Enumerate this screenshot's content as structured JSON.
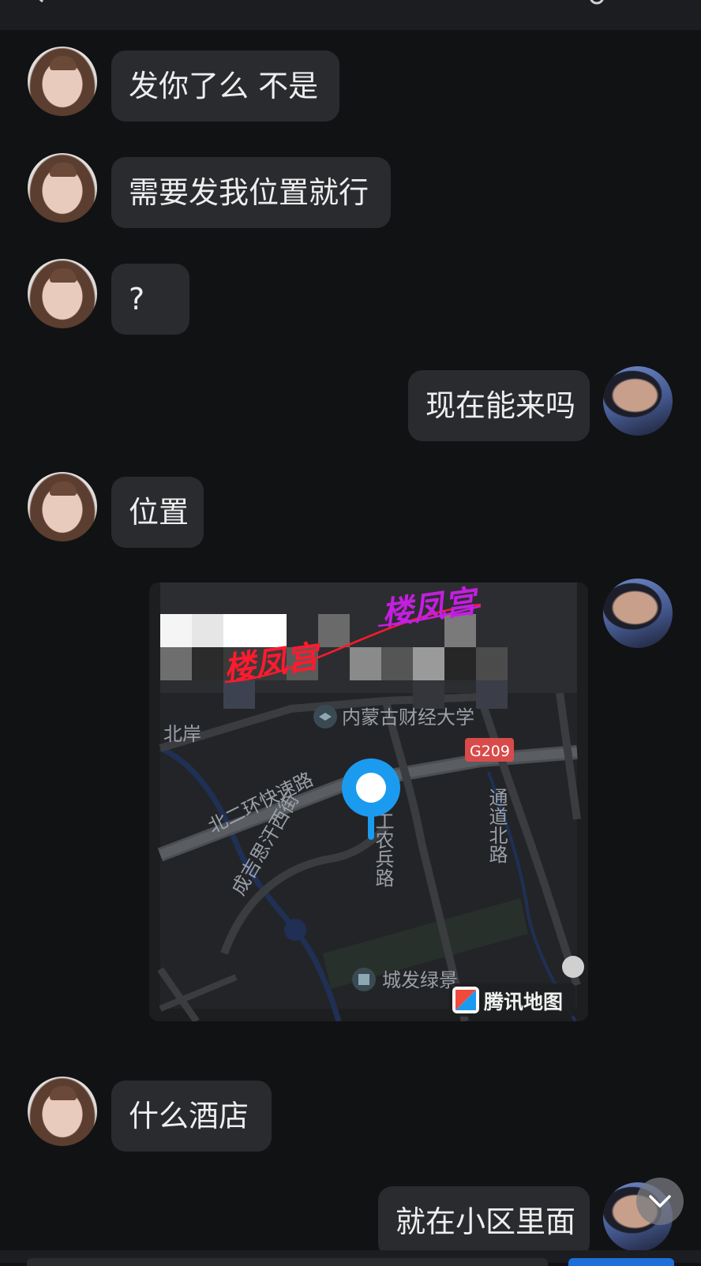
{
  "messages": [
    {
      "side": "left",
      "text": "发你了么 不是"
    },
    {
      "side": "left",
      "text": "需要发我位置就行"
    },
    {
      "side": "left",
      "text": "?"
    },
    {
      "side": "right",
      "text": "现在能来吗"
    },
    {
      "side": "left",
      "text": "位置"
    },
    {
      "side": "right",
      "type": "location"
    },
    {
      "side": "left",
      "text": "什么酒店"
    },
    {
      "side": "right",
      "text": "就在小区里面"
    }
  ],
  "map": {
    "watermark_1": "楼凤宫",
    "watermark_2": "楼凤宫",
    "poi_university": "内蒙古财经大学",
    "place_north_bank": "北岸",
    "road_badge": "G209",
    "road_ring": "北二环快速路",
    "road_genghis": "成吉思汗西街",
    "road_gongnong": "工农兵路",
    "road_tongdao": "通道北路",
    "poi_green": "城发绿景",
    "brand": "腾讯地图"
  },
  "colors": {
    "background": "#111214",
    "bubble": "#2a2b2f",
    "text": "#eeeeee",
    "pin": "#1a9bf0",
    "watermark_red": "#ff1a2e",
    "watermark_purple": "#c41ee0"
  }
}
